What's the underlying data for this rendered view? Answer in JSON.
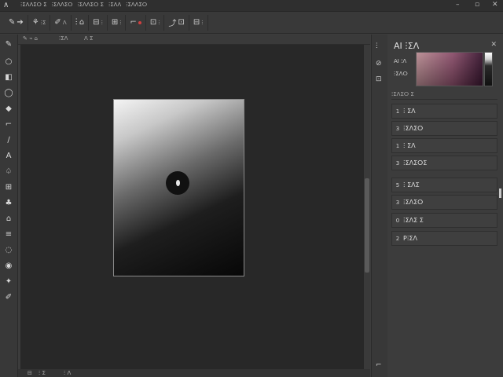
{
  "menubar": {
    "logo": "∧",
    "items": [
      "ⵗⵉⴷⴷⵉⵔ ⵉ",
      "ⵗⵉⴷⴷⵉⵔ",
      "ⵗⵉⴷⴷⵉⵔ ⵉ",
      "ⵗⵉⴷⴷ",
      "ⵗⵉⴷⴷⵉⵔ"
    ],
    "window_minimize": "–",
    "window_restore": "▫",
    "window_close": "✕"
  },
  "options": {
    "groups": [
      {
        "icon": "✎",
        "extra": "➔"
      },
      {
        "icon": "⚘",
        "extra": "ⵗⵉ"
      },
      {
        "icon": "✐",
        "extra": "ⴷ"
      },
      {
        "icon": "ⵗ",
        "extra": "⌂"
      },
      {
        "icon": "⊟",
        "extra": "ⵗ"
      },
      {
        "icon": "⊞",
        "extra": "ⵗ"
      },
      {
        "icon": "⌐",
        "extra": "ⵗ"
      },
      {
        "icon": "⊡",
        "extra": "ⵗ"
      },
      {
        "icon": "⤴",
        "extra": "⊡"
      },
      {
        "icon": "⊟",
        "extra": "ⵗ"
      }
    ]
  },
  "toolbar": {
    "tools": [
      "✎",
      "○",
      "◧",
      "◯",
      "◆",
      "⌐",
      "∕",
      "A",
      "♤",
      "⊞",
      "♣",
      "⌂",
      "≡",
      "◌",
      "◉",
      "✦",
      "✐"
    ]
  },
  "doc_tab": {
    "items": [
      "✎ ⌁ ⌂",
      "ⵗⵉⴷ",
      "ⴷ ⵉ"
    ]
  },
  "status_bar": {
    "items": [
      "⊟",
      "ⵗ ⵉ",
      "ⵗ ⴷ"
    ]
  },
  "midbar": {
    "icons": [
      "ⵗ",
      "⊘",
      "⊡",
      "⌐"
    ]
  },
  "panel": {
    "title": "AI ⵗⵉⴷ",
    "close": "✕",
    "label_1": "AI ⵗⴷ",
    "label_2": "ⵗⵉⴷⵔ",
    "subhead": "ⵗⵉⴷⵉⵔ ⵉ",
    "layers": [
      {
        "num": "1",
        "label": "ⵗ ⵉⴷ"
      },
      {
        "num": "3",
        "label": "ⵗⵉⴷⵉⵔ"
      },
      {
        "num": "1",
        "label": "ⵗ ⵉⴷ"
      },
      {
        "num": "3",
        "label": "ⵗⵉⴷⵉⵔⵉ"
      },
      {
        "num": "5",
        "label": "ⵗ ⵉⴷⵉ"
      },
      {
        "num": "3",
        "label": "ⵗⵉⴷⵉⵔ"
      },
      {
        "num": "0",
        "label": "ⵗⵉⴷⵉ ⵉ"
      },
      {
        "num": "2",
        "label": "Pⵗⵉⴷ"
      }
    ]
  },
  "colors": {
    "accent": "#8b4f6b",
    "canvas_bg": "#282828",
    "panel_bg": "#3c3c3c"
  }
}
